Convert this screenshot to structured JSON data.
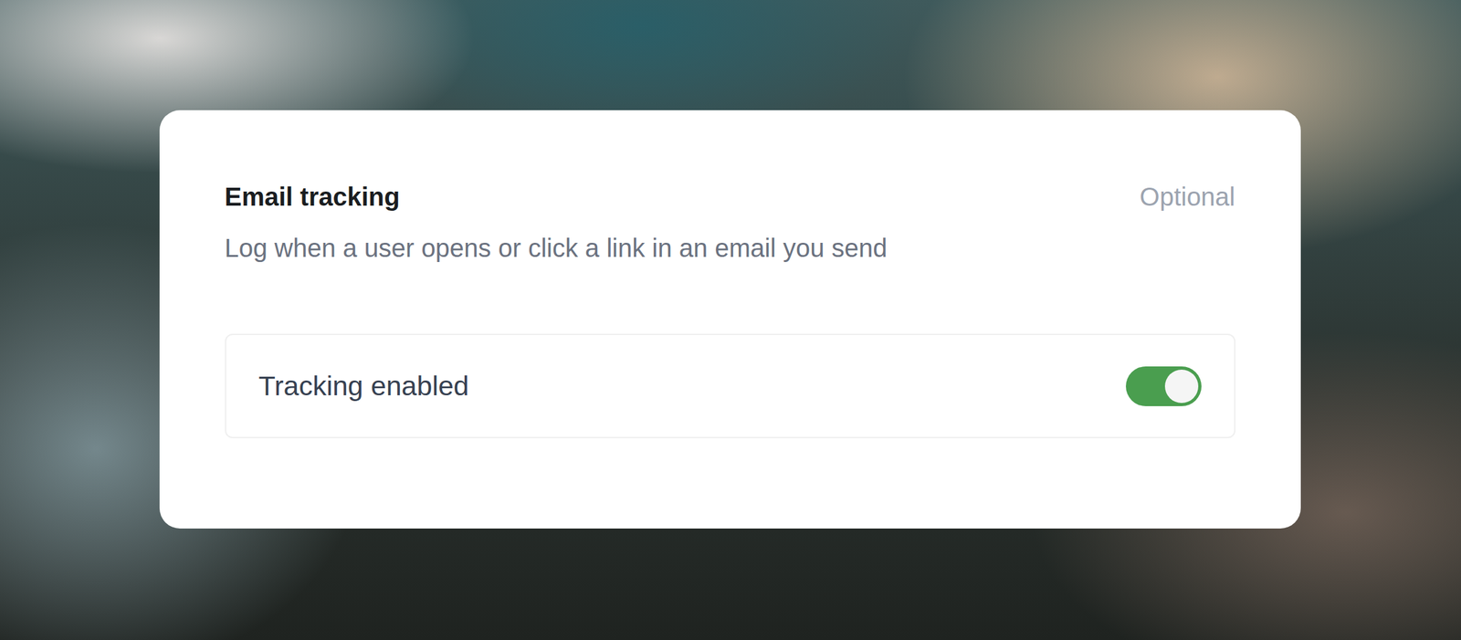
{
  "card": {
    "title": "Email tracking",
    "badge": "Optional",
    "description": "Log when a user opens or click a link in an email you send"
  },
  "setting": {
    "label": "Tracking enabled",
    "on": true
  }
}
